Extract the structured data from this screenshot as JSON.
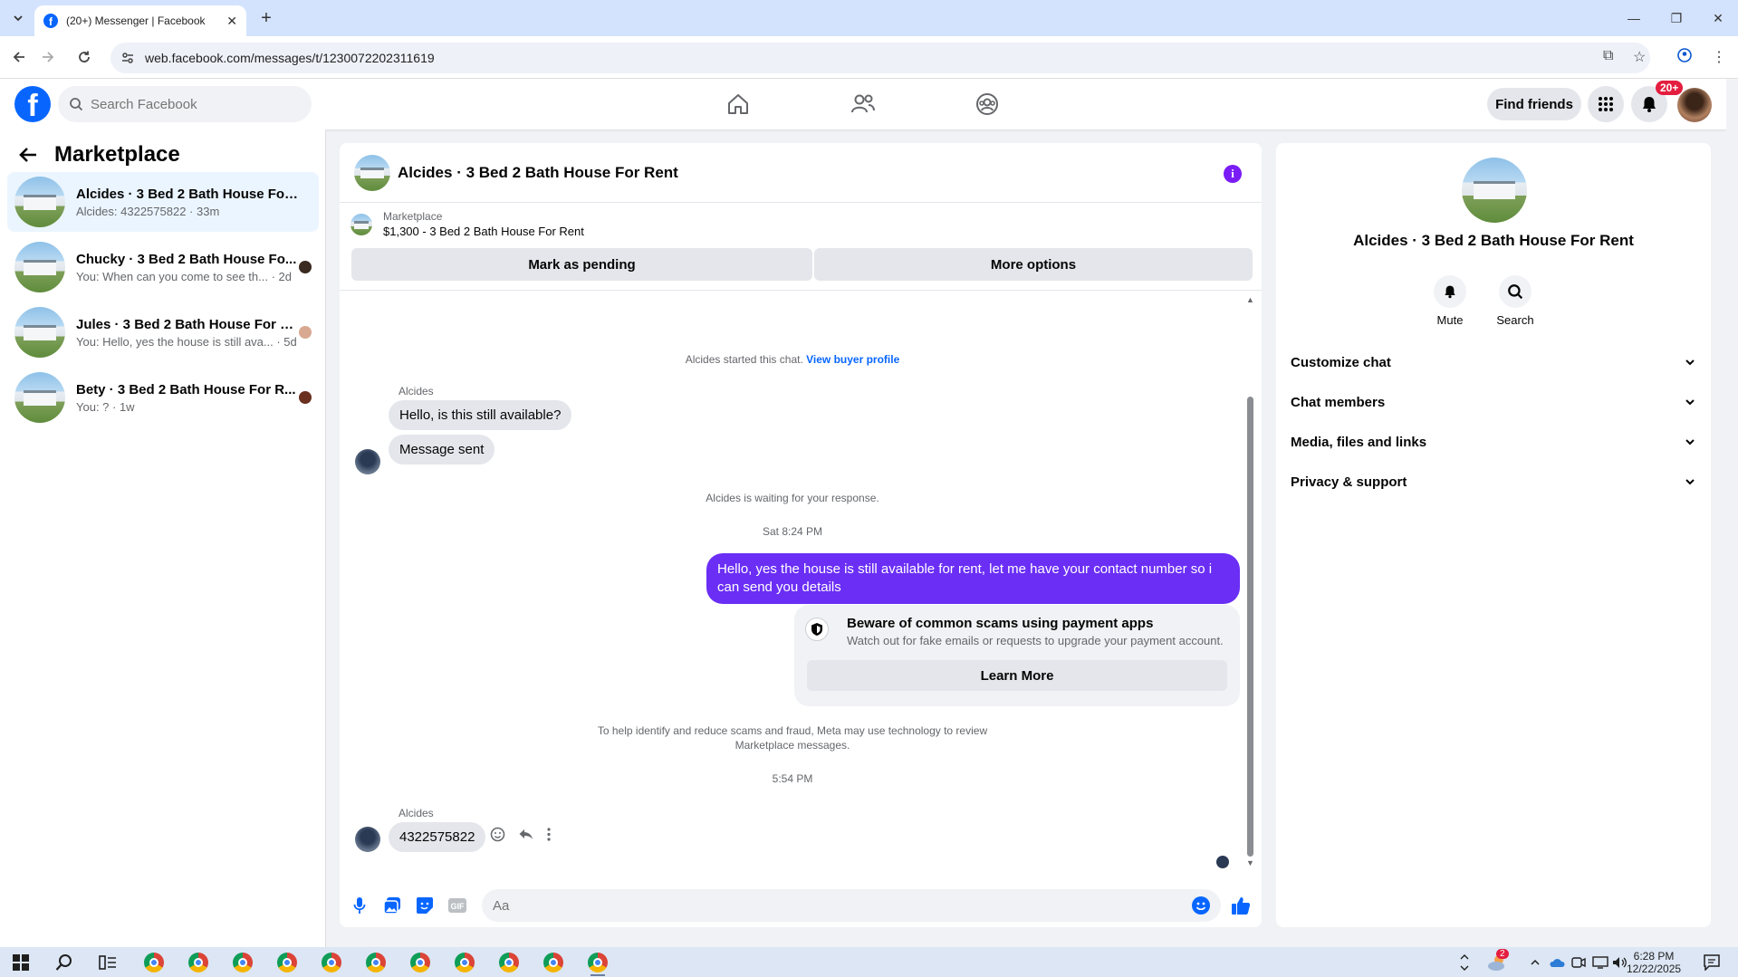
{
  "browser": {
    "tab_title": "(20+) Messenger | Facebook",
    "url": "web.facebook.com/messages/t/1230072202311619"
  },
  "header": {
    "search_placeholder": "Search Facebook",
    "find_friends": "Find friends",
    "notification_badge": "20+"
  },
  "sidebar": {
    "title": "Marketplace",
    "conversations": [
      {
        "name": "Alcides · 3 Bed 2 Bath House For R...",
        "preview": "Alcides: 4322575822 · 33m",
        "active": true
      },
      {
        "name": "Chucky · 3 Bed 2 Bath House Fo...",
        "preview": "You: When can you come to see th... · 2d",
        "active": false
      },
      {
        "name": "Jules · 3 Bed 2 Bath House For R...",
        "preview": "You: Hello, yes the house is still ava... · 5d",
        "active": false
      },
      {
        "name": "Bety · 3 Bed 2 Bath House For R...",
        "preview": "You: ? · 1w",
        "active": false
      }
    ]
  },
  "chat": {
    "title": "Alcides · 3 Bed 2 Bath House For Rent",
    "marketplace_label": "Marketplace",
    "listing": "$1,300 - 3 Bed 2 Bath House For Rent",
    "mark_pending": "Mark as pending",
    "more_options": "More options",
    "started_text": "Alcides started this chat.",
    "view_buyer_profile": "View buyer profile",
    "sender_name": "Alcides",
    "msg1": "Hello, is this still available?",
    "msg2": "Message sent",
    "waiting": "Alcides is waiting for your response.",
    "time1": "Sat 8:24 PM",
    "my_msg": "Hello, yes the house is still available for rent, let me have your contact number so i can send you  details",
    "scam_title": "Beware of common scams using payment apps",
    "scam_text": "Watch out for fake emails or requests to upgrade your payment account.",
    "learn_more": "Learn More",
    "meta_notice_1": "To help identify and reduce scams and fraud, Meta may use technology to review",
    "meta_notice_2": "Marketplace messages.",
    "time2": "5:54 PM",
    "sender_name2": "Alcides",
    "msg3": "4322575822",
    "composer_placeholder": "Aa",
    "gif_label": "GIF"
  },
  "details": {
    "title": "Alcides · 3 Bed 2 Bath House For Rent",
    "mute": "Mute",
    "search": "Search",
    "sections": [
      "Customize chat",
      "Chat members",
      "Media, files and links",
      "Privacy & support"
    ]
  },
  "taskbar": {
    "time": "6:28 PM",
    "date": "12/22/2025",
    "weather_badge": "2"
  },
  "colors": {
    "brand": "#0866ff",
    "my_bubble": "#6b2ef5",
    "active_conv": "#ebf5ff"
  }
}
